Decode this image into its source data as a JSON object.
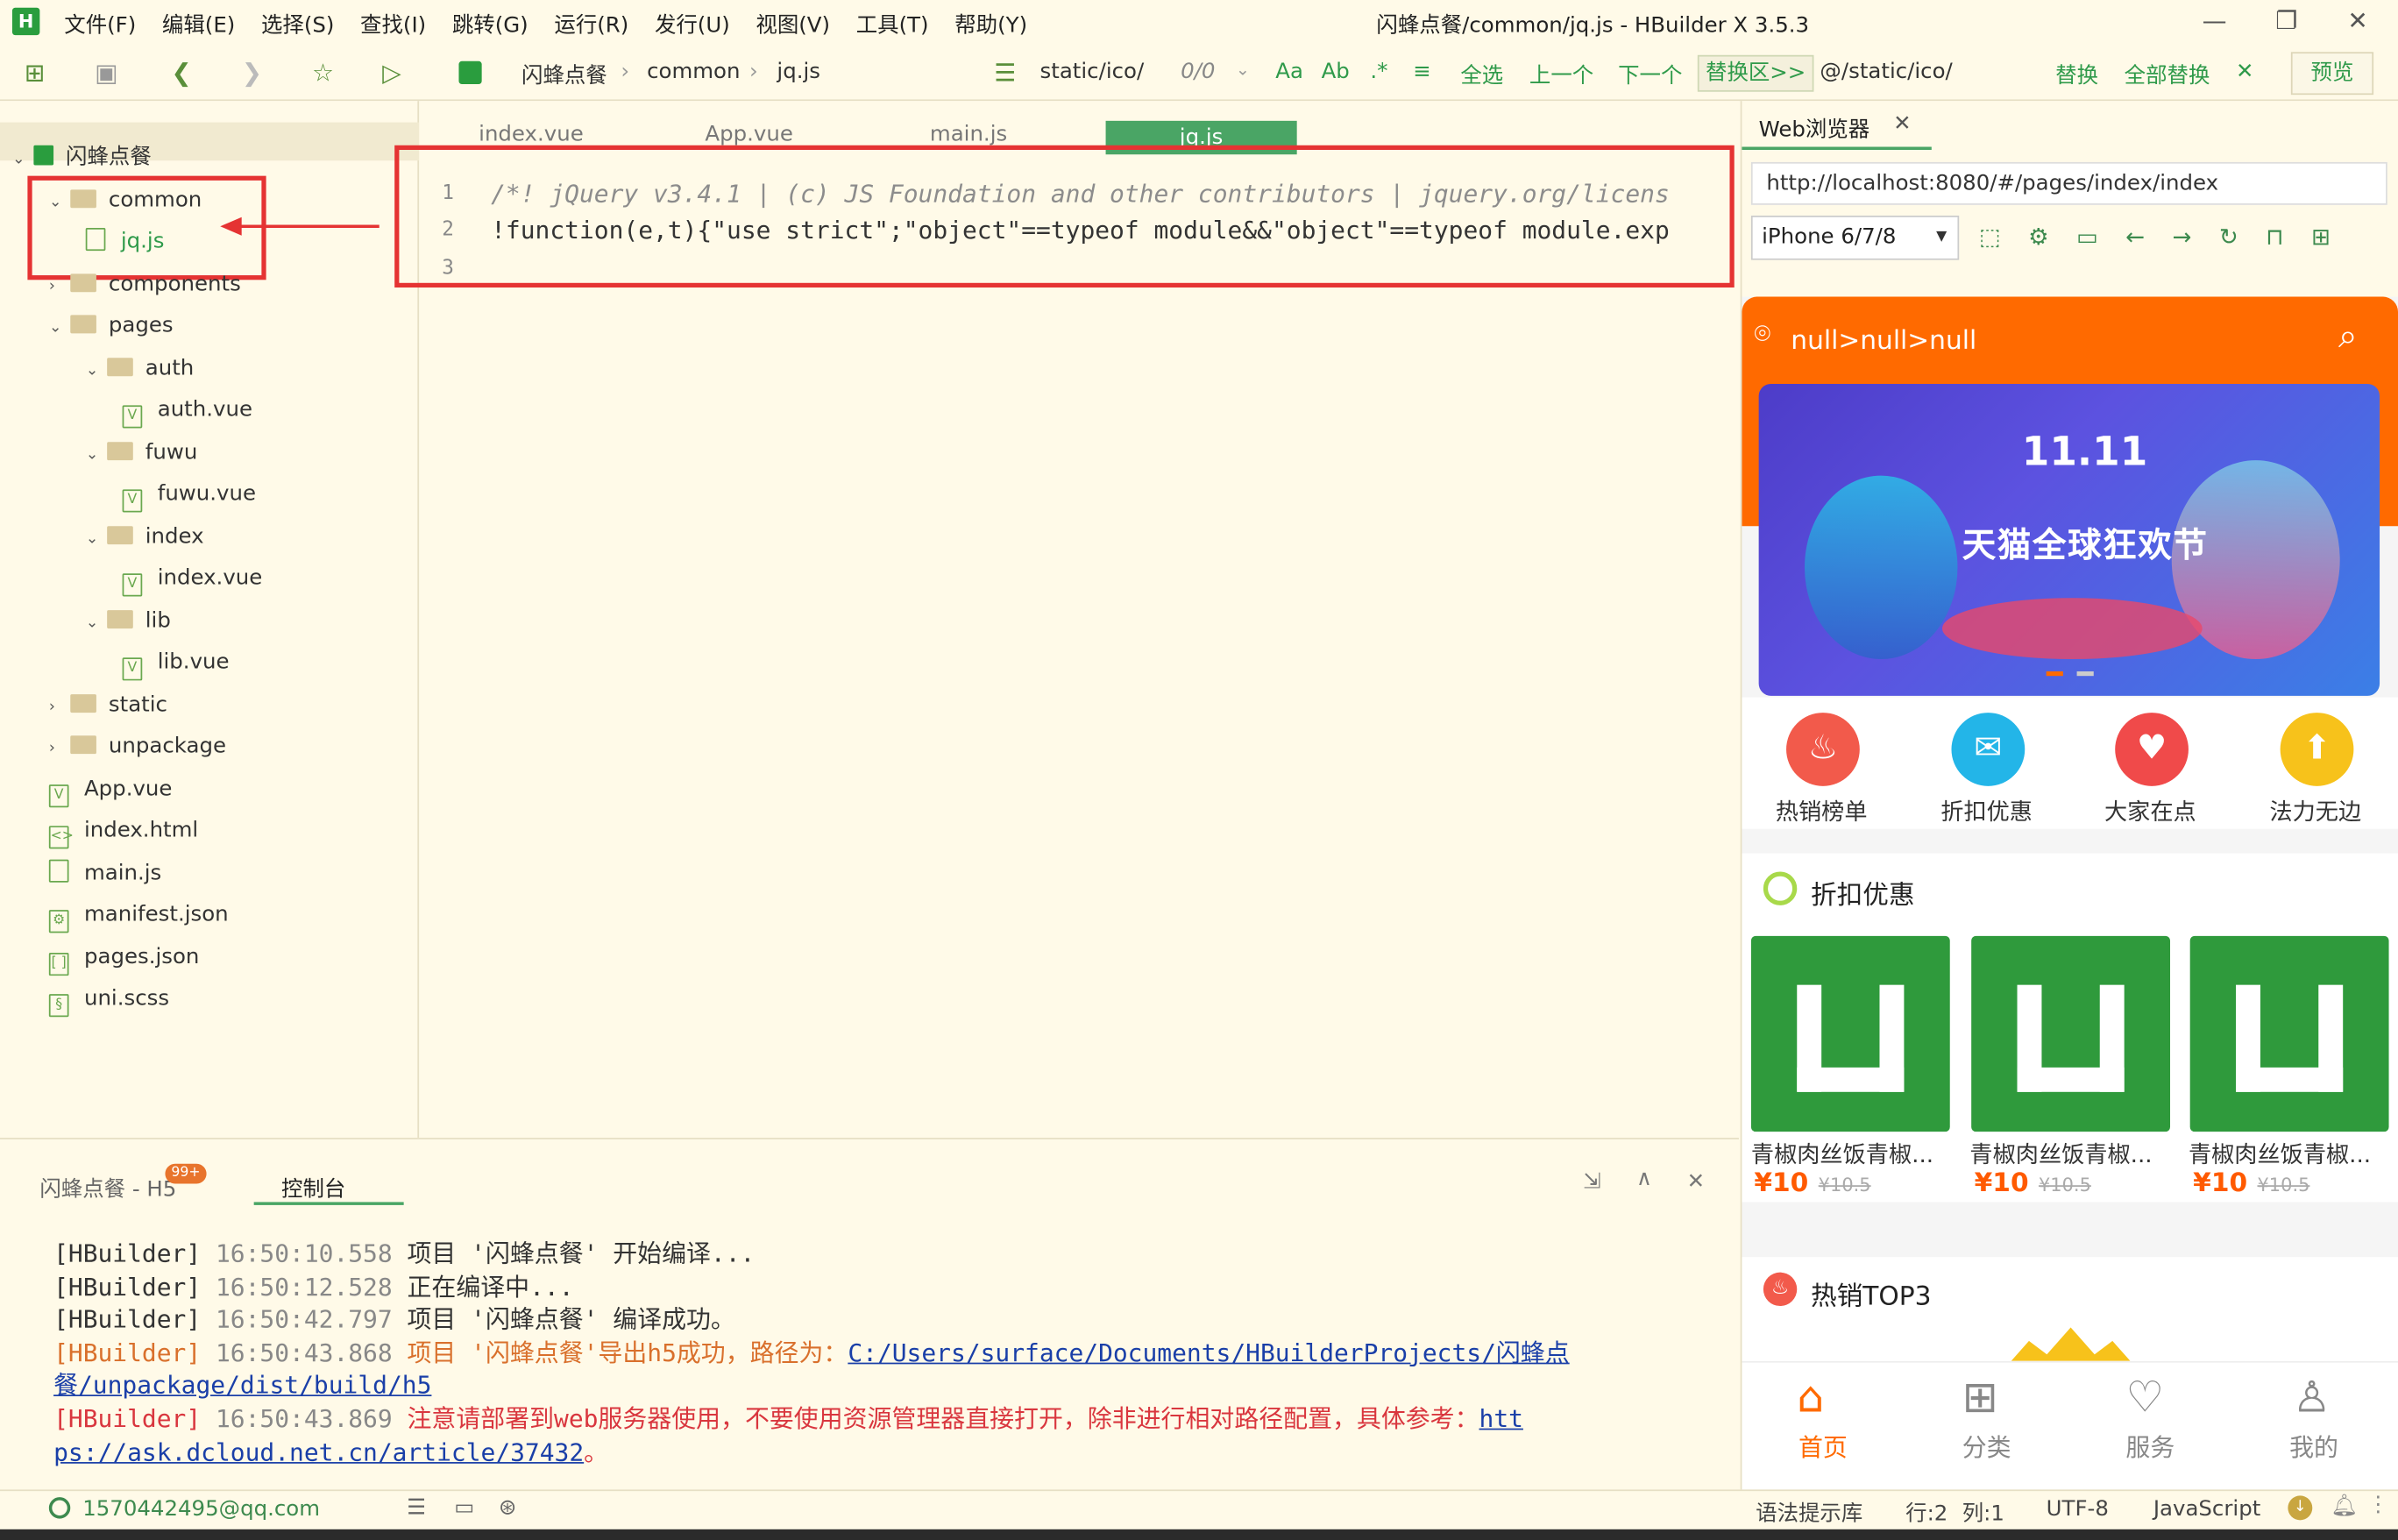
{
  "app": {
    "logo": "H",
    "title": "闪蜂点餐/common/jq.js - HBuilder X 3.5.3"
  },
  "menu": [
    "文件(F)",
    "编辑(E)",
    "选择(S)",
    "查找(I)",
    "跳转(G)",
    "运行(R)",
    "发行(U)",
    "视图(V)",
    "工具(T)",
    "帮助(Y)"
  ],
  "toolbar": {
    "crumbs": [
      "闪蜂点餐",
      "common",
      "jq.js"
    ],
    "search_text": "static/ico/",
    "match_count": "0/0",
    "select_all": "全选",
    "prev": "上一个",
    "next": "下一个",
    "replace_zone": "替换区>>",
    "replace_text": "@/static/ico/",
    "replace": "替换",
    "replace_all": "全部替换",
    "preview": "预览"
  },
  "tree": [
    {
      "label": "闪蜂点餐",
      "kind": "project",
      "depth": 0
    },
    {
      "label": "common",
      "kind": "folder",
      "depth": 1
    },
    {
      "label": "jq.js",
      "kind": "js",
      "depth": 2
    },
    {
      "label": "components",
      "kind": "folder",
      "depth": 1
    },
    {
      "label": "pages",
      "kind": "folder",
      "depth": 1
    },
    {
      "label": "auth",
      "kind": "folder",
      "depth": 2
    },
    {
      "label": "auth.vue",
      "kind": "vue",
      "depth": 3
    },
    {
      "label": "fuwu",
      "kind": "folder",
      "depth": 2
    },
    {
      "label": "fuwu.vue",
      "kind": "vue",
      "depth": 3
    },
    {
      "label": "index",
      "kind": "folder",
      "depth": 2
    },
    {
      "label": "index.vue",
      "kind": "vue",
      "depth": 3
    },
    {
      "label": "lib",
      "kind": "folder",
      "depth": 2
    },
    {
      "label": "lib.vue",
      "kind": "vue",
      "depth": 3
    },
    {
      "label": "static",
      "kind": "folder",
      "depth": 1
    },
    {
      "label": "unpackage",
      "kind": "folder",
      "depth": 1
    },
    {
      "label": "App.vue",
      "kind": "vue",
      "depth": 1
    },
    {
      "label": "index.html",
      "kind": "html",
      "depth": 1
    },
    {
      "label": "main.js",
      "kind": "js",
      "depth": 1
    },
    {
      "label": "manifest.json",
      "kind": "json",
      "depth": 1
    },
    {
      "label": "pages.json",
      "kind": "json2",
      "depth": 1
    },
    {
      "label": "uni.scss",
      "kind": "scss",
      "depth": 1
    }
  ],
  "editor_tabs": [
    "index.vue",
    "App.vue",
    "main.js",
    "jq.js"
  ],
  "code_lines": [
    {
      "num": "1",
      "text": "/*! jQuery v3.4.1 | (c) JS Foundation and other contributors | jquery.org/licens"
    },
    {
      "num": "2",
      "text": "!function(e,t){\"use strict\";\"object\"==typeof module&&\"object\"==typeof module.exp"
    },
    {
      "num": "3",
      "text": ""
    }
  ],
  "console": {
    "tab_project": "闪蜂点餐 - H5",
    "badge": "99+",
    "tab_console": "控制台",
    "lines": [
      {
        "prefix": "[HBuilder]",
        "time": "16:50:10.558",
        "msg": "项目 '闪蜂点餐' 开始编译..."
      },
      {
        "prefix": "[HBuilder]",
        "time": "16:50:12.528",
        "msg": "正在编译中..."
      },
      {
        "prefix": "[HBuilder]",
        "time": "16:50:42.797",
        "msg": "项目 '闪蜂点餐' 编译成功。"
      },
      {
        "prefix": "[HBuilder]",
        "time": "16:50:43.868",
        "msg": "项目 '闪蜂点餐'导出h5成功，路径为：",
        "link1": "C:/Users/surface/Documents/HBuilderProjects/闪蜂点",
        "link2": "餐/unpackage/dist/build/h5"
      },
      {
        "prefix": "[HBuilder]",
        "time": "16:50:43.869",
        "msg": "注意请部署到web服务器使用，不要使用资源管理器直接打开，除非进行相对路径配置，具体参考：",
        "link1": "htt",
        "link2": "ps://ask.dcloud.net.cn/article/37432",
        "tail": "。"
      }
    ]
  },
  "browser": {
    "tab": "Web浏览器",
    "url": "http://localhost:8080/#/pages/index/index",
    "device": "iPhone 6/7/8"
  },
  "phone": {
    "location": "null>null>null",
    "banner_text": "天猫全球狂欢节",
    "banner_logo": "11.11",
    "categories": [
      {
        "label": "热销榜单",
        "color": "#f25a4b"
      },
      {
        "label": "折扣优惠",
        "color": "#23b5e8"
      },
      {
        "label": "大家在点",
        "color": "#f04a4a"
      },
      {
        "label": "法力无边",
        "color": "#f7c21b"
      }
    ],
    "discount_title": "折扣优惠",
    "products": [
      {
        "name": "青椒肉丝饭青椒...",
        "price": "¥10",
        "old_price": "¥10.5"
      },
      {
        "name": "青椒肉丝饭青椒...",
        "price": "¥10",
        "old_price": "¥10.5"
      },
      {
        "name": "青椒肉丝饭青椒...",
        "price": "¥10",
        "old_price": "¥10.5"
      }
    ],
    "hot_title": "热销TOP3",
    "nav": [
      {
        "label": "首页",
        "active": true
      },
      {
        "label": "分类",
        "active": false
      },
      {
        "label": "服务",
        "active": false
      },
      {
        "label": "我的",
        "active": false
      }
    ]
  },
  "status": {
    "user": "1570442495@qq.com",
    "hint_lib": "语法提示库",
    "line": "行:2",
    "col": "列:1",
    "encoding": "UTF-8",
    "language": "JavaScript"
  }
}
